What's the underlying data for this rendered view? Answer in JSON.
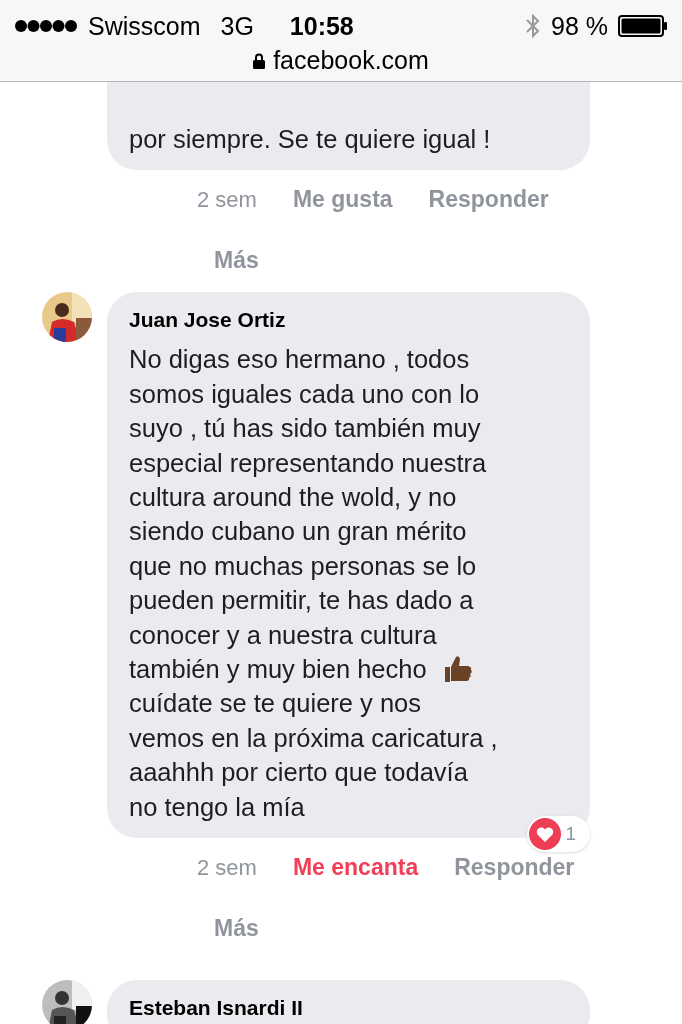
{
  "status_bar": {
    "carrier": "Swisscom",
    "network": "3G",
    "time": "10:58",
    "battery": "98 %"
  },
  "address_bar": {
    "url": "facebook.com"
  },
  "comments": [
    {
      "lines": [
        {
          "text": "por siempre. Se te quiere igual !",
          "thumb": false
        }
      ],
      "time": "2 sem",
      "like": "Me gusta",
      "liked": false,
      "reply": "Responder",
      "more": "Más"
    },
    {
      "author": "Juan Jose Ortiz",
      "lines": [
        {
          "text": "No digas eso hermano , todos",
          "thumb": false
        },
        {
          "text": "somos iguales cada uno con lo",
          "thumb": false
        },
        {
          "text": "suyo , tú has sido también muy",
          "thumb": false
        },
        {
          "text": "especial representando nuestra",
          "thumb": false
        },
        {
          "text": "cultura around the wold, y no",
          "thumb": false
        },
        {
          "text": "siendo cubano un gran mérito",
          "thumb": false
        },
        {
          "text": "que no muchas personas se lo",
          "thumb": false
        },
        {
          "text": "pueden permitir, te has dado a",
          "thumb": false
        },
        {
          "text": "conocer y a nuestra cultura",
          "thumb": false
        },
        {
          "text": "también y muy bien hecho",
          "thumb": true
        },
        {
          "text": "cuídate se te quiere y nos",
          "thumb": false
        },
        {
          "text": "vemos en la próxima caricatura ,",
          "thumb": false
        },
        {
          "text": "aaahhh por cierto que todavía",
          "thumb": false
        },
        {
          "text": "no tengo la mía",
          "thumb": false
        }
      ],
      "reactions": {
        "count": "1"
      },
      "time": "2 sem",
      "like": "Me encanta",
      "liked": true,
      "reply": "Responder",
      "more": "Más"
    },
    {
      "author": "Esteban Isnardi II"
    }
  ]
}
